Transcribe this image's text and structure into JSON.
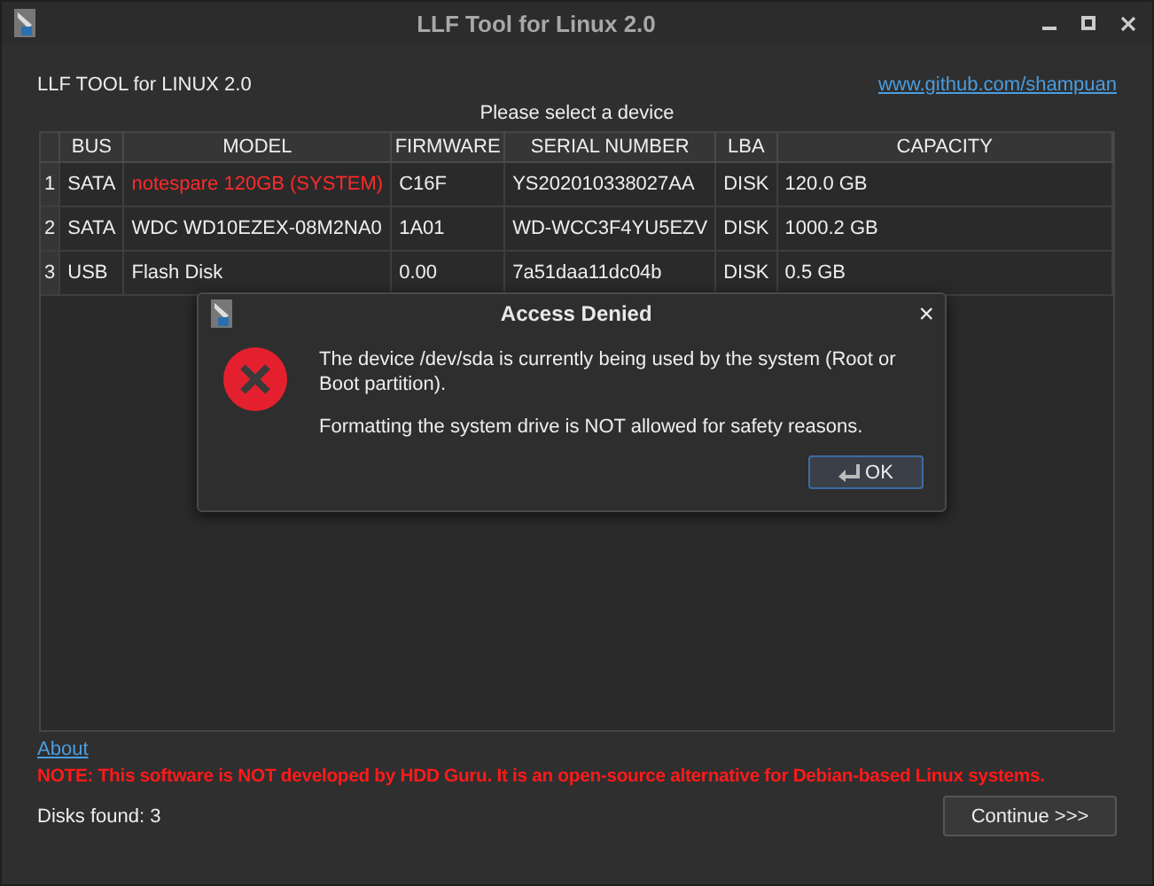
{
  "window": {
    "title": "LLF Tool for Linux 2.0"
  },
  "header": {
    "app_name": "LLF TOOL for LINUX 2.0",
    "link": "www.github.com/shampuan",
    "prompt": "Please select a device"
  },
  "table": {
    "columns": [
      "BUS",
      "MODEL",
      "FIRMWARE",
      "SERIAL NUMBER",
      "LBA",
      "CAPACITY"
    ],
    "rows": [
      {
        "number": "1",
        "system": true,
        "cells": [
          "SATA",
          "notespare 120GB (SYSTEM)",
          "C16F",
          "YS202010338027AA",
          "DISK",
          "120.0 GB"
        ]
      },
      {
        "number": "2",
        "system": false,
        "cells": [
          "SATA",
          "WDC WD10EZEX-08M2NA0",
          "1A01",
          "WD-WCC3F4YU5EZV",
          "DISK",
          "1000.2 GB"
        ]
      },
      {
        "number": "3",
        "system": false,
        "cells": [
          "USB",
          "Flash Disk",
          "0.00",
          "7a51daa11dc04b",
          "DISK",
          "0.5 GB"
        ]
      }
    ]
  },
  "about_link": "About",
  "note": "NOTE: This software is NOT developed by HDD Guru. It is an open-source alternative for Debian-based Linux systems.",
  "status": "Disks found: 3",
  "continue_button": "Continue >>>",
  "dialog": {
    "title": "Access Denied",
    "close": "×",
    "message": "The device /dev/sda is currently being used by the system (Root or Boot partition).",
    "detail": "Formatting the system drive is NOT allowed for safety reasons.",
    "button": "OK"
  }
}
